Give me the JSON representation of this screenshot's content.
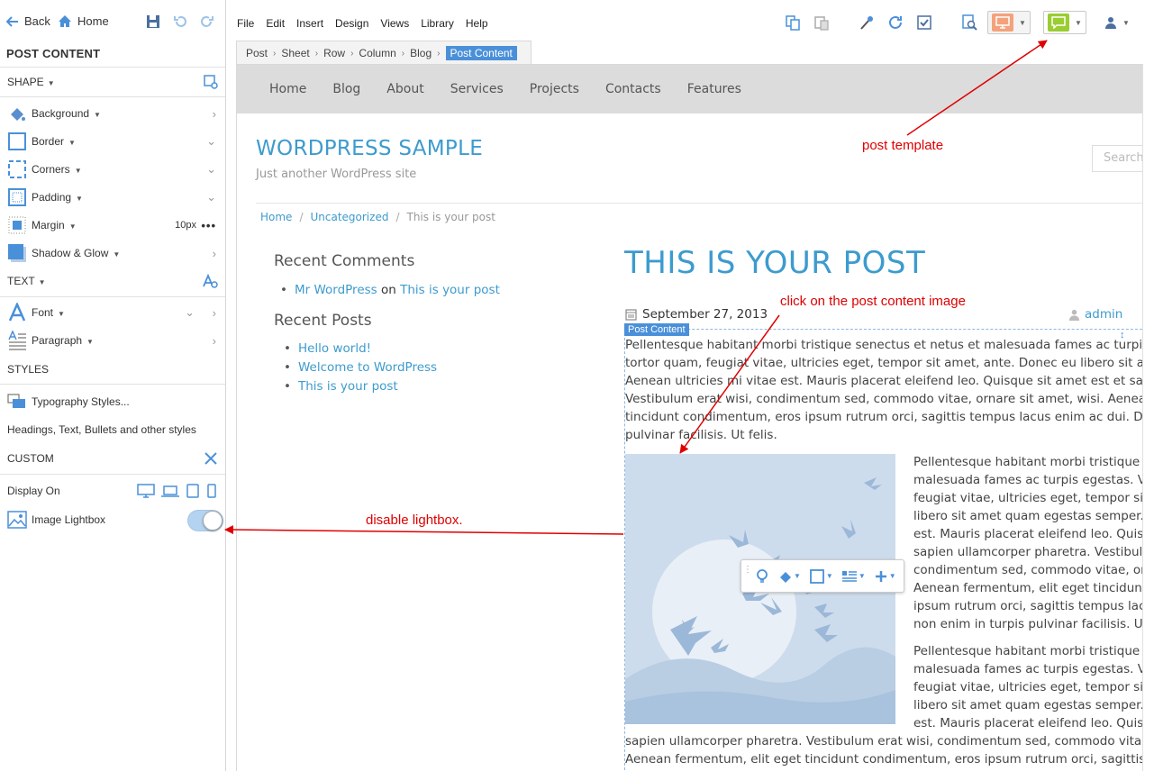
{
  "sidebar": {
    "back": "Back",
    "home": "Home",
    "title": "POST CONTENT",
    "sections": {
      "shape": "SHAPE",
      "text": "TEXT",
      "styles": "STYLES",
      "custom": "CUSTOM"
    },
    "shape_items": [
      {
        "label": "Background"
      },
      {
        "label": "Border"
      },
      {
        "label": "Corners"
      },
      {
        "label": "Padding"
      },
      {
        "label": "Margin",
        "value": "10px"
      },
      {
        "label": "Shadow & Glow"
      }
    ],
    "text_items": [
      {
        "label": "Font"
      },
      {
        "label": "Paragraph"
      }
    ],
    "typography_styles": "Typography Styles...",
    "styles_desc": "Headings, Text, Bullets and other styles",
    "display_on": "Display On",
    "image_lightbox": "Image Lightbox",
    "image_lightbox_on": true
  },
  "menu": [
    "File",
    "Edit",
    "Insert",
    "Design",
    "Views",
    "Library",
    "Help"
  ],
  "breadcrumb": [
    "Post",
    "Sheet",
    "Row",
    "Column",
    "Blog",
    "Post Content"
  ],
  "site": {
    "nav": [
      "Home",
      "Blog",
      "About",
      "Services",
      "Projects",
      "Contacts",
      "Features"
    ],
    "title": "WORDPRESS SAMPLE",
    "tagline": "Just another WordPress site",
    "search_placeholder": "Search",
    "breadcrumb": [
      "Home",
      "Uncategorized",
      "This is your post"
    ],
    "recent_comments_title": "Recent Comments",
    "recent_comment": {
      "author": "Mr WordPress",
      "on": "on",
      "post": "This is your post"
    },
    "recent_posts_title": "Recent Posts",
    "recent_posts": [
      "Hello world!",
      "Welcome to WordPress",
      "This is your post"
    ]
  },
  "post": {
    "title": "THIS IS YOUR POST",
    "date": "September 27, 2013",
    "author": "admin",
    "content_label": "Post Content",
    "para1": [
      "Pellentesque habitant morbi tristique senectus et netus et malesuada fames ac turpis eg",
      "tortor quam, feugiat vitae, ultricies eget, tempor sit amet, ante. Donec eu libero sit amet",
      "Aenean ultricies mi vitae est. Mauris placerat eleifend leo. Quisque sit amet est et sapien",
      "Vestibulum erat wisi, condimentum sed, commodo vitae, ornare sit amet, wisi. Aenean fe",
      "tincidunt condimentum, eros ipsum rutrum orci, sagittis tempus lacus enim ac dui. Done",
      "pulvinar facilisis. Ut felis."
    ],
    "para2": [
      "Pellentesque habitant morbi tristique se",
      "malesuada fames ac turpis egestas. Ves",
      "feugiat vitae, ultricies eget, tempor sit a",
      "libero sit amet quam egestas semper. A",
      "est. Mauris placerat eleifend leo. Quisq",
      "sapien ullamcorper pharetra. Vestibulu",
      "condimentum sed, commodo vitae, orn",
      "Aenean fermentum, elit eget tincidunt c",
      "ipsum rutrum orci, sagittis tempus lacu",
      "non enim in turpis pulvinar facilisis. Ut f"
    ],
    "para3": [
      "Pellentesque habitant morbi tristique se",
      "malesuada fames ac turpis egestas. Ves",
      "feugiat vitae, ultricies eget, tempor sit a",
      "libero sit amet quam egestas semper. A",
      "est. Mauris placerat eleifend leo. Quisq"
    ],
    "para4": [
      "sapien ullamcorper pharetra. Vestibulum erat wisi, condimentum sed, commodo vitae, o",
      "Aenean fermentum, elit eget tincidunt condimentum, eros ipsum rutrum orci, sagittis ter"
    ]
  },
  "annotations": {
    "post_template": "post template",
    "click_image": "click on the post content image",
    "disable_lightbox": "disable lightbox."
  },
  "colors": {
    "accent": "#3d9bce",
    "selection": "#4a90d9",
    "annotation": "#e00000",
    "preview_button": "#f4a27b",
    "template_button": "#9acd32"
  }
}
